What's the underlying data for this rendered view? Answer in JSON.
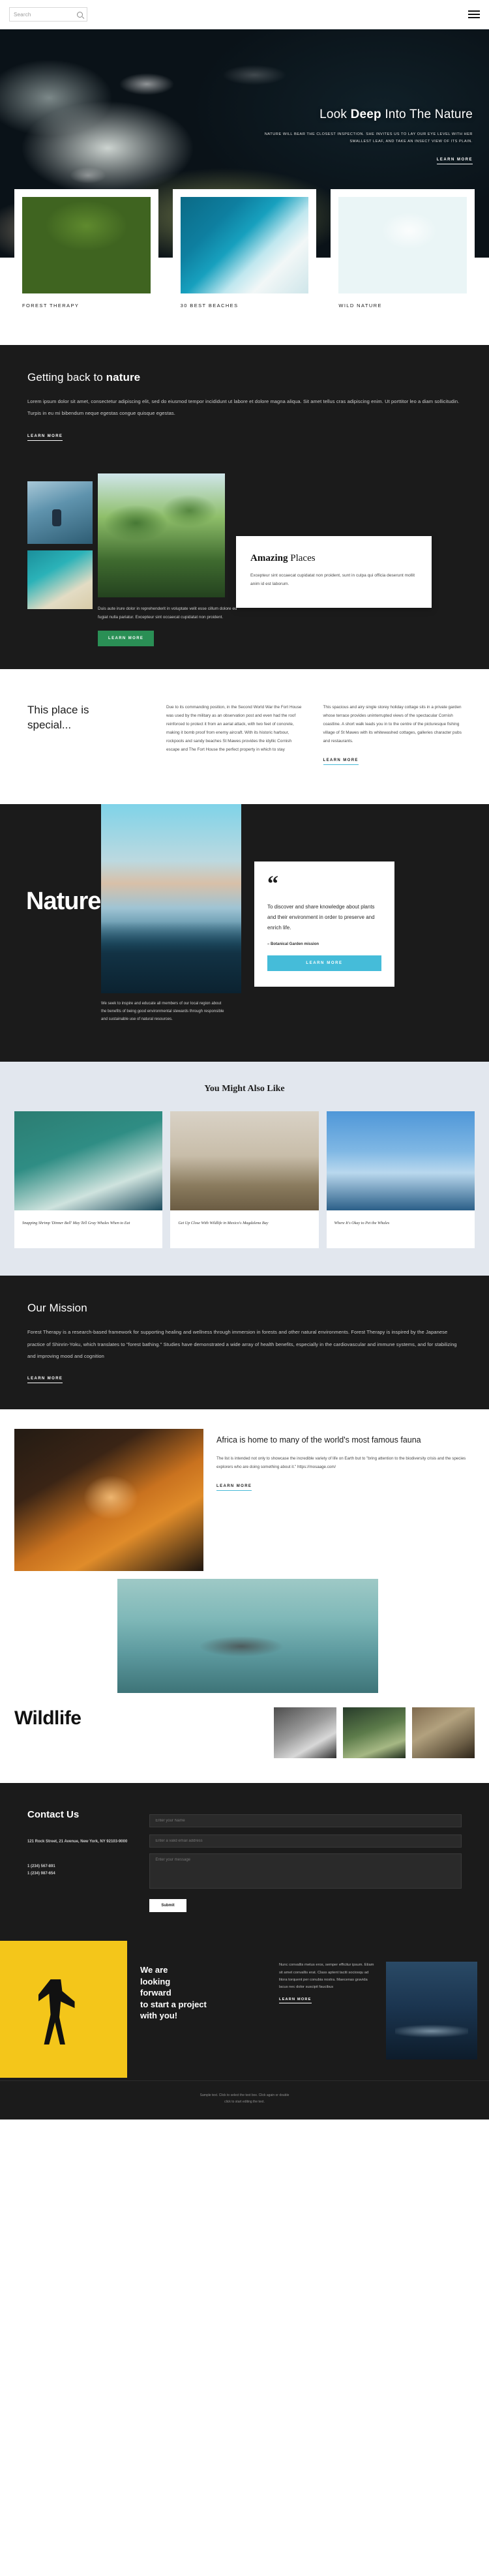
{
  "topbar": {
    "search_placeholder": "Search",
    "search_value": "",
    "search_icon": "search-icon",
    "menu_icon": "hamburger-menu-icon"
  },
  "hero": {
    "title_plain_1": "Look ",
    "title_bold": "Deep",
    "title_plain_2": " Into The Nature",
    "subtitle": "NATURE WILL BEAR THE CLOSEST INSPECTION. SHE INVITES US TO LAY OUR EYE LEVEL WITH HER SMALLEST LEAF, AND TAKE AN INSECT VIEW OF ITS PLAIN.",
    "cta": "Learn More"
  },
  "cards": [
    {
      "caption": "Forest Therapy",
      "image": "pine-tree-photo"
    },
    {
      "caption": "30 Best Beaches",
      "image": "aerial-ocean-shore-photo"
    },
    {
      "caption": "Wild Nature",
      "image": "iceberg-boat-photo"
    }
  ],
  "getting_back": {
    "title_plain": "Getting back to ",
    "title_bold": "nature",
    "body": "Lorem ipsum dolor sit amet, consectetur adipiscing elit, sed do eiusmod tempor incididunt ut labore et dolore magna aliqua. Sit amet tellus cras adipiscing enim. Ut porttitor leo a diam sollicitudin. Turpis in eu mi bibendum neque egestas congue quisque egestas.",
    "cta": "Learn More"
  },
  "amazing": {
    "panel_title_bold": "Amazing",
    "panel_title_plain": " Places",
    "panel_body": "Excepteur sint occaecat cupidatat non proident, sunt in culpa qui officia deserunt mollit anim id est laborum.",
    "side_body": "Duis aute irure dolor in reprehenderit in voluptate velit esse cillum dolore eu fugiat nulla pariatur. Excepteur sint occaecat cupidatat non proident.",
    "cta": "Learn More",
    "images": [
      "person-in-water-photo",
      "palm-trees-photo",
      "turquoise-shore-photo"
    ]
  },
  "special": {
    "title_line1": "This place is",
    "title_line2": "special...",
    "col1": "Due to its commanding position, in the Second World War the Fort House was used by the military as an observation post and even had the roof reinforced to protect it from an aerial attack, with two feet of concrete, making it bomb proof from enemy aircraft. With its historic harbour, rockpools and sandy beaches St Mawes provides the idyllic Cornish escape and The Fort House the perfect property in which to stay",
    "col2": "This spacious and airy single storey holiday cottage sits in a private garden whose terrace provides uninterrupted views of the spectacular Cornish coastline. A short walk leads you in to the centre of the picturesque fishing village of St Mawes with its whitewashed cottages, galleries character pubs and restaurants.",
    "cta": "Learn More"
  },
  "nature": {
    "word": "Nature",
    "quote_mark": "“",
    "quote": "To discover and share knowledge about plants and their environment in order to preserve and enrich life.",
    "attribution": "– Botanical Garden mission",
    "cta": "Learn More",
    "note": "We seek to inspire and educate all members of our local region about the benefits of being good environmental stewards through responsible and sustainable use of natural resources.",
    "image": "mountain-above-clouds-photo"
  },
  "you_might": {
    "title": "You Might Also Like",
    "items": [
      {
        "caption": "Snapping Shrimp 'Dinner Bell' May Tell Gray Whales When to Eat",
        "image": "whale-in-ocean-photo"
      },
      {
        "caption": "Get Up Close With Wildlife in Mexico's Magdalena Bay",
        "image": "birds-flock-photo"
      },
      {
        "caption": "Where It's Okay to Pet the Whales",
        "image": "breaching-whale-photo"
      }
    ]
  },
  "mission": {
    "title": "Our Mission",
    "body": "Forest Therapy is a research-based framework for supporting healing and wellness through immersion in forests and other natural environments. Forest Therapy is inspired by the Japanese practice of Shinrin-Yoku, which translates to \"forest bathing.\" Studies have demonstrated a wide array of health benefits, especially in the cardiovascular and immune systems, and for stabilizing and improving mood and cognition",
    "cta": "Learn More"
  },
  "wildlife": {
    "heading": "Africa is home to many of the world's most famous fauna",
    "body": "The list is intended not only to showcase the incredible variety of life on Earth but to \"bring attention to the biodiversity crisis and the species explorers who are doing something about it.\" https://mosaage.com/",
    "cta": "Learn More",
    "word": "Wildlife",
    "images": [
      "tiger-portrait-photo",
      "hippos-in-water-photo",
      "zebra-photo",
      "giraffe-photo",
      "monkey-photo"
    ]
  },
  "contact": {
    "title": "Contact Us",
    "address": "121 Rock Street, 21 Avenue, New York, NY 92103-9000",
    "phone1": "1 (234) 567-891",
    "phone2": "1 (234) 987-654",
    "name_placeholder": "Enter your Name",
    "email_placeholder": "Enter a valid email address",
    "message_placeholder": "Enter your message",
    "submit_label": "Submit"
  },
  "promo": {
    "heading_line1": "We are",
    "heading_line2": "looking",
    "heading_line3": "forward",
    "heading_line4": "to start a project",
    "heading_line5": "with you!",
    "body": "Nunc convallis metus eros, semper efficitur ipsum. Etiam sit amet convallis erat. Class aptent taciti sociosqu ad litora torquent per conubia nostra. Maecenas gravida lacus nec dolor suscipit faucibus",
    "cta": "Learn More",
    "left_image": "photographer-silhouette-graphic",
    "right_image": "night-mountain-photo"
  },
  "footer": {
    "line1": "Sample text. Click to select the text box. Click again or double",
    "line2": "click to start editing the text."
  }
}
